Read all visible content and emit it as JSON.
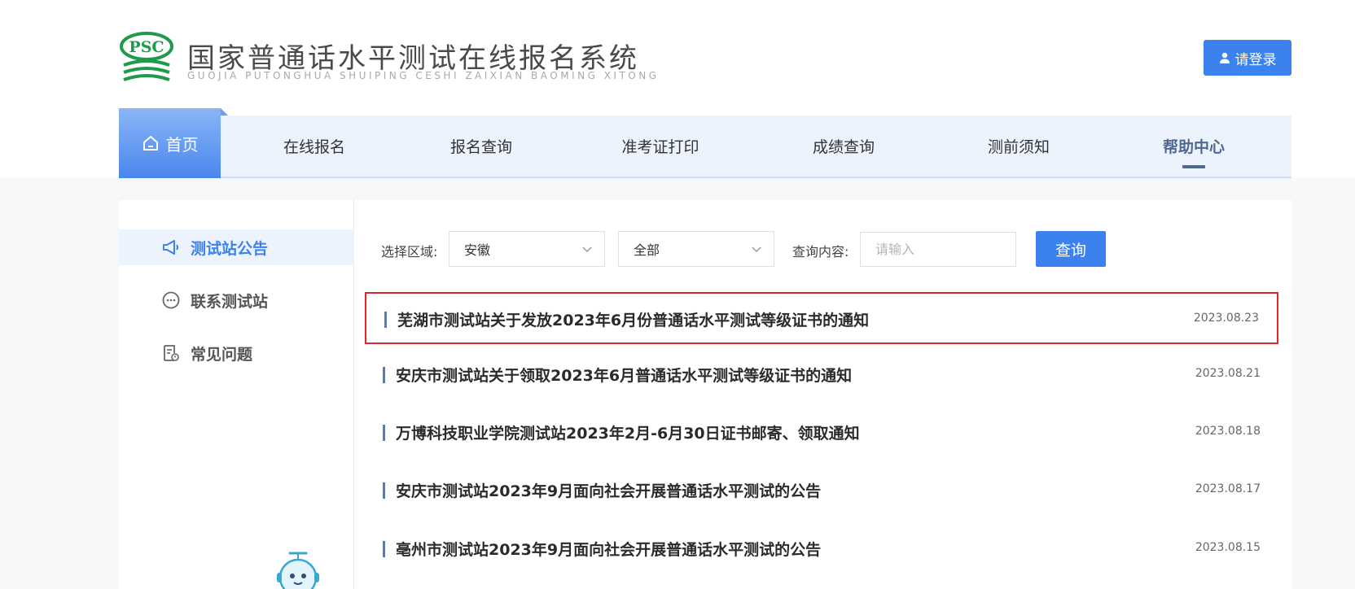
{
  "header": {
    "logo_badge": "PSC",
    "title": "国家普通话水平测试在线报名系统",
    "subtitle": "GUOJIA PUTONGHUA SHUIPING CESHI ZAIXIAN BAOMING XITONG",
    "login_label": "请登录"
  },
  "nav": {
    "home": "首页",
    "items": [
      "在线报名",
      "报名查询",
      "准考证打印",
      "成绩查询",
      "测前须知",
      "帮助中心"
    ],
    "active": "帮助中心"
  },
  "sidebar": {
    "items": [
      {
        "label": "测试站公告",
        "icon": "megaphone-icon"
      },
      {
        "label": "联系测试站",
        "icon": "chat-icon"
      },
      {
        "label": "常见问题",
        "icon": "faq-doc-icon"
      }
    ]
  },
  "filter": {
    "region_label": "选择区域:",
    "region_value": "安徽",
    "scope_value": "全部",
    "query_label": "查询内容:",
    "query_placeholder": "请输入",
    "search_label": "查询"
  },
  "news": [
    {
      "title": "芜湖市测试站关于发放2023年6月份普通话水平测试等级证书的通知",
      "date": "2023.08.23"
    },
    {
      "title": "安庆市测试站关于领取2023年6月普通话水平测试等级证书的通知",
      "date": "2023.08.21"
    },
    {
      "title": "万博科技职业学院测试站2023年2月-6月30日证书邮寄、领取通知",
      "date": "2023.08.18"
    },
    {
      "title": "安庆市测试站2023年9月面向社会开展普通话水平测试的公告",
      "date": "2023.08.17"
    },
    {
      "title": "亳州市测试站2023年9月面向社会开展普通话水平测试的公告",
      "date": "2023.08.15"
    }
  ],
  "colors": {
    "accent": "#3c82ef",
    "highlight": "#e0262d",
    "nav_active": "#506a8f"
  }
}
